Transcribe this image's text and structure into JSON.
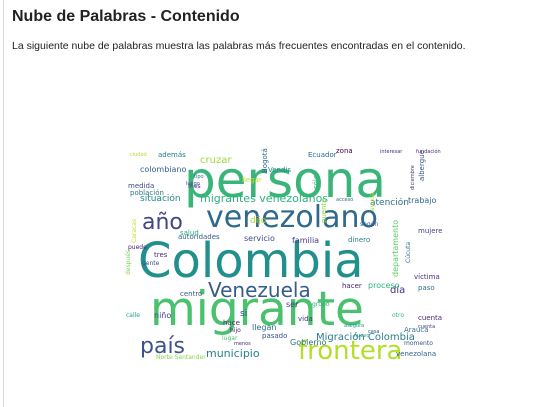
{
  "header": {
    "title": "Nube de Palabras - Contenido"
  },
  "description": "La siguiente nube de palabras muestra las palabras más frecuentes encontradas en el contenido.",
  "wordcloud": {
    "words": [
      {
        "text": "persona",
        "color": "#3ab57a"
      },
      {
        "text": "Colombia",
        "color": "#21908c"
      },
      {
        "text": "migrante",
        "color": "#4ac16d"
      },
      {
        "text": "venezolano",
        "color": "#30698e"
      },
      {
        "text": "año",
        "color": "#404688"
      },
      {
        "text": "frontera",
        "color": "#b5de2b"
      },
      {
        "text": "país",
        "color": "#3b528b"
      },
      {
        "text": "Venezuela",
        "color": "#375b8d"
      },
      {
        "text": "migrantes venezolanos",
        "color": "#2cb17e"
      },
      {
        "text": "municipio",
        "color": "#25838e"
      },
      {
        "text": "Migración Colombia",
        "color": "#287d8e"
      },
      {
        "text": "Gobierno",
        "color": "#2e6f8e"
      },
      {
        "text": "día",
        "color": "#46327e"
      },
      {
        "text": "situación",
        "color": "#24868e"
      },
      {
        "text": "colombiano",
        "color": "#35608d"
      },
      {
        "text": "población",
        "color": "#2a788e"
      },
      {
        "text": "familia",
        "color": "#433e85"
      },
      {
        "text": "servicio",
        "color": "#3f4889"
      },
      {
        "text": "autoridades",
        "color": "#355f8d"
      },
      {
        "text": "atención",
        "color": "#2c728e"
      },
      {
        "text": "trabajo",
        "color": "#32658e"
      },
      {
        "text": "cruzar",
        "color": "#9bd93c"
      },
      {
        "text": "llegar",
        "color": "#bddf26"
      },
      {
        "text": "Ecuador",
        "color": "#2f6b8e"
      },
      {
        "text": "Bogotá",
        "color": "#31688e"
      },
      {
        "text": "Vendis",
        "color": "#277f8e"
      },
      {
        "text": "medida",
        "color": "#3e4a89"
      },
      {
        "text": "niño",
        "color": "#414487"
      },
      {
        "text": "centro",
        "color": "#365c8d"
      },
      {
        "text": "hacer",
        "color": "#481c6e"
      },
      {
        "text": "pasado",
        "color": "#3c4f8a"
      },
      {
        "text": "llegan",
        "color": "#2d708e"
      },
      {
        "text": "vida",
        "color": "#453781"
      },
      {
        "text": "Norte Santander",
        "color": "#86d549"
      },
      {
        "text": "Arauca",
        "color": "#2a768e"
      },
      {
        "text": "momento",
        "color": "#3b518b"
      },
      {
        "text": "venezolana",
        "color": "#33638d"
      },
      {
        "text": "cuenta",
        "color": "#482979"
      },
      {
        "text": "dinero",
        "color": "#26828e"
      },
      {
        "text": "mujeres",
        "color": "#414387"
      },
      {
        "text": "según",
        "color": "#3a548c"
      },
      {
        "text": "proceso",
        "color": "#2db27d"
      },
      {
        "text": "salud",
        "color": "#25ac82"
      },
      {
        "text": "tres",
        "color": "#472f7d"
      },
      {
        "text": "gente",
        "color": "#3d4e8a"
      },
      {
        "text": "puede",
        "color": "#482173"
      },
      {
        "text": "ser",
        "color": "#443983"
      },
      {
        "text": "si",
        "color": "#3e4989"
      },
      {
        "text": "hace",
        "color": "#46307e"
      },
      {
        "text": "dijo",
        "color": "#addc30"
      },
      {
        "text": "sólo",
        "color": "#31b57b"
      },
      {
        "text": "además",
        "color": "#287c8e"
      },
      {
        "text": "albergue",
        "color": "#3a538b"
      },
      {
        "text": "departamento",
        "color": "#5ec962"
      },
      {
        "text": "Cúcuta",
        "color": "#2b748e"
      },
      {
        "text": "víctima",
        "color": "#46337f"
      },
      {
        "text": "Caracas",
        "color": "#c2df23"
      },
      {
        "text": "puente",
        "color": "#8bd646"
      },
      {
        "text": "diciembre",
        "color": "#472c7a"
      },
      {
        "text": "zona",
        "color": "#440154"
      },
      {
        "text": "fundación",
        "color": "#482576"
      },
      {
        "text": "interesar",
        "color": "#46307e"
      },
      {
        "text": "paso",
        "color": "#2c718e"
      },
      {
        "text": "calle",
        "color": "#1fa088"
      },
      {
        "text": "después",
        "color": "#7cd250"
      },
      {
        "text": "otro",
        "color": "#37b878"
      },
      {
        "text": "hijo",
        "color": "#481b6d"
      },
      {
        "text": "casa",
        "color": "#3b528b"
      },
      {
        "text": "ciudad",
        "color": "#b8de29"
      },
      {
        "text": "nuevo",
        "color": "#1e9b8a"
      },
      {
        "text": "grupo",
        "color": "#26ad81"
      },
      {
        "text": "lugar",
        "color": "#4ec36b"
      },
      {
        "text": "mes",
        "color": "#482878"
      },
      {
        "text": "tipo",
        "color": "#2d708e"
      },
      {
        "text": "luego",
        "color": "#3e4c8a"
      },
      {
        "text": "acceso",
        "color": "#2f6c8e"
      },
      {
        "text": "asegura",
        "color": "#1f988b"
      },
      {
        "text": "ayuda",
        "color": "#a2da37"
      },
      {
        "text": "menos",
        "color": "#472a7a"
      },
      {
        "text": "cuenta",
        "color": "#414487"
      }
    ]
  }
}
